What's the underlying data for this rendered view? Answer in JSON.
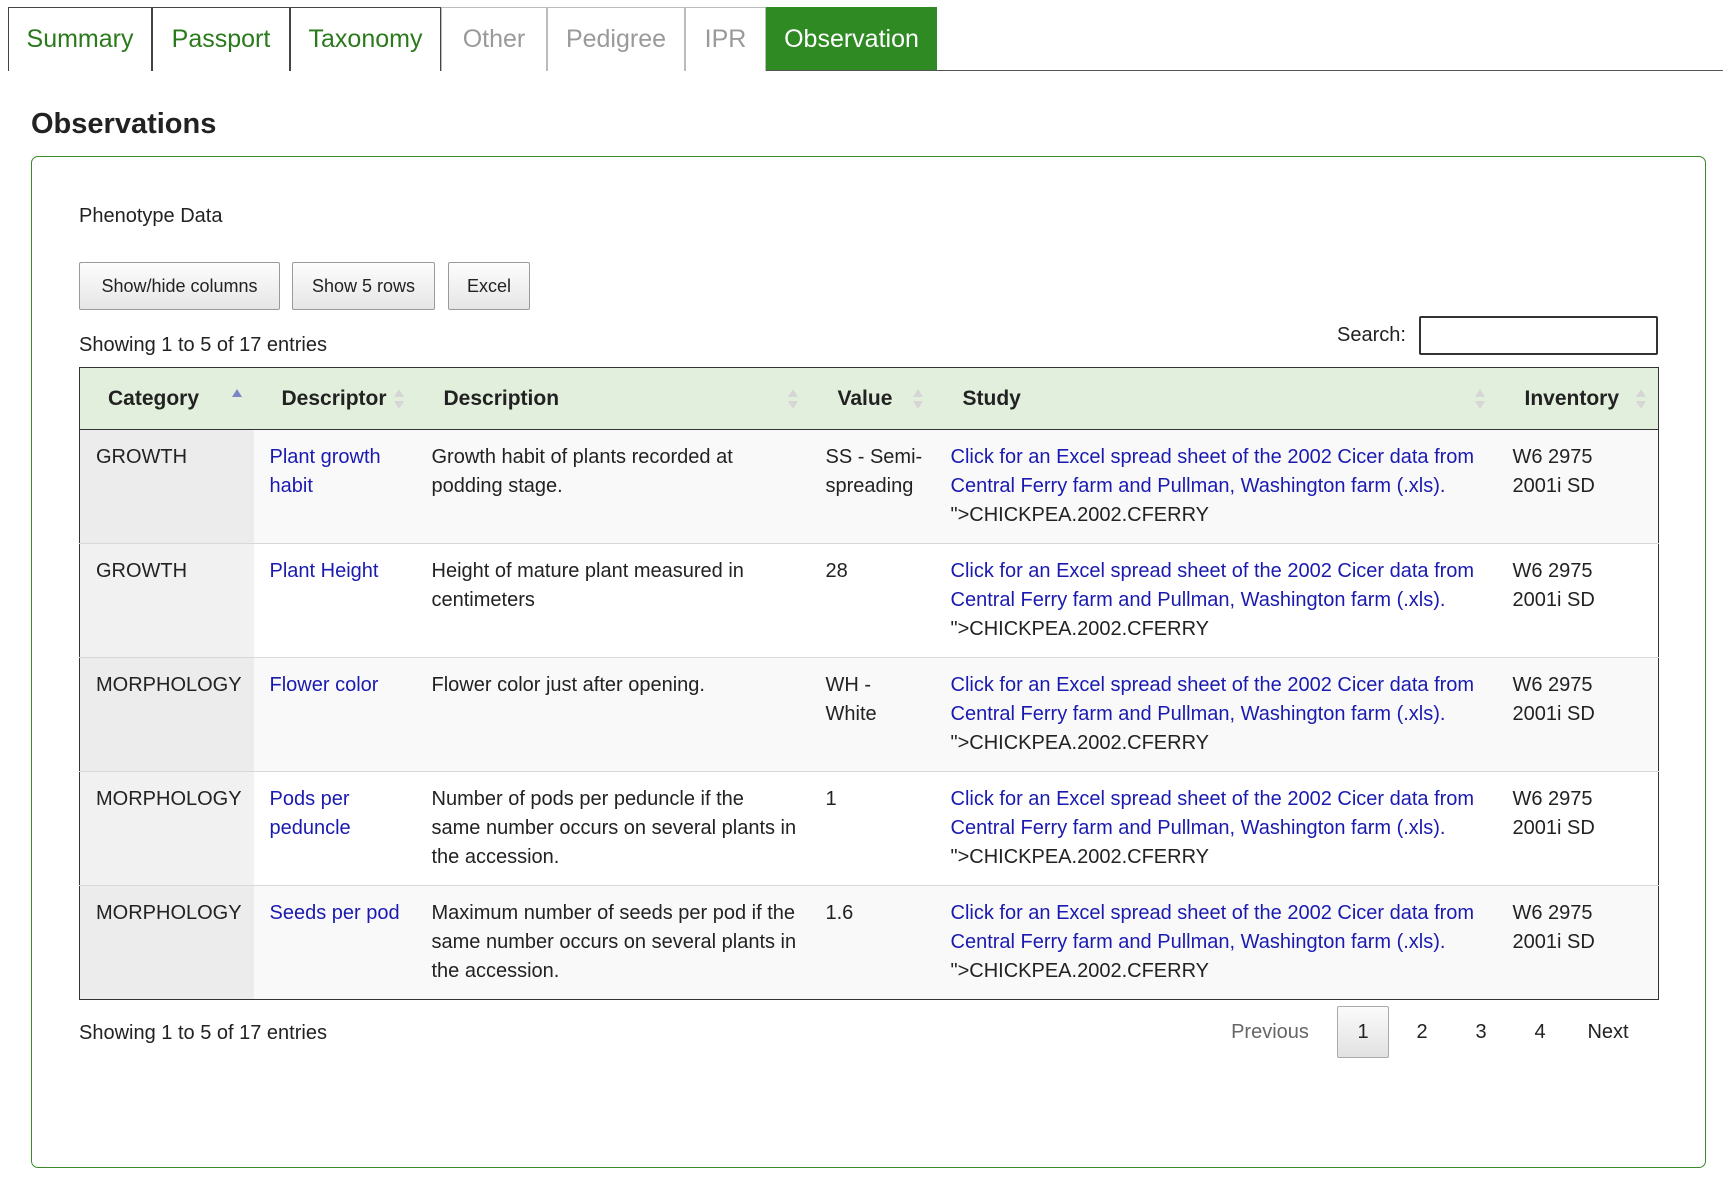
{
  "tabs": [
    {
      "label": "Summary",
      "state": "enabled"
    },
    {
      "label": "Passport",
      "state": "enabled"
    },
    {
      "label": "Taxonomy",
      "state": "enabled"
    },
    {
      "label": "Other",
      "state": "disabled"
    },
    {
      "label": "Pedigree",
      "state": "disabled"
    },
    {
      "label": "IPR",
      "state": "disabled"
    },
    {
      "label": "Observation",
      "state": "active"
    }
  ],
  "page_title": "Observations",
  "section_label": "Phenotype Data",
  "toolbar": {
    "colvis_label": "Show/hide columns",
    "rows_label": "Show 5 rows",
    "excel_label": "Excel"
  },
  "info_text": "Showing 1 to 5 of 17 entries",
  "search": {
    "label": "Search:",
    "value": "",
    "placeholder": ""
  },
  "table": {
    "columns": [
      "Category",
      "Descriptor",
      "Description",
      "Value",
      "Study",
      "Inventory"
    ],
    "sorted_column": "Category",
    "rows": [
      {
        "category": "GROWTH",
        "descriptor": "Plant growth habit",
        "description": "Growth habit of plants recorded at podding stage.",
        "value": "SS - Semi-spreading",
        "study_link": "Click for an Excel spread sheet of the 2002 Cicer data from Central Ferry farm and Pullman, Washington farm (.xls).",
        "study_suffix": " \">CHICKPEA.2002.CFERRY",
        "inventory": "W6 2975 2001i SD"
      },
      {
        "category": "GROWTH",
        "descriptor": "Plant Height",
        "description": "Height of mature plant measured in centimeters",
        "value": "28",
        "study_link": "Click for an Excel spread sheet of the 2002 Cicer data from Central Ferry farm and Pullman, Washington farm (.xls).",
        "study_suffix": " \">CHICKPEA.2002.CFERRY",
        "inventory": "W6 2975 2001i SD"
      },
      {
        "category": "MORPHOLOGY",
        "descriptor": "Flower color",
        "description": "Flower color just after opening.",
        "value": "WH - White",
        "study_link": "Click for an Excel spread sheet of the 2002 Cicer data from Central Ferry farm and Pullman, Washington farm (.xls).",
        "study_suffix": " \">CHICKPEA.2002.CFERRY",
        "inventory": "W6 2975 2001i SD"
      },
      {
        "category": "MORPHOLOGY",
        "descriptor": "Pods per peduncle",
        "description": "Number of pods per peduncle if the same number occurs on several plants in the accession.",
        "value": "1",
        "study_link": "Click for an Excel spread sheet of the 2002 Cicer data from Central Ferry farm and Pullman, Washington farm (.xls).",
        "study_suffix": " \">CHICKPEA.2002.CFERRY",
        "inventory": "W6 2975 2001i SD"
      },
      {
        "category": "MORPHOLOGY",
        "descriptor": "Seeds per pod",
        "description": "Maximum number of seeds per pod if the same number occurs on several plants in the accession.",
        "value": "1.6",
        "study_link": "Click for an Excel spread sheet of the 2002 Cicer data from Central Ferry farm and Pullman, Washington farm (.xls).",
        "study_suffix": " \">CHICKPEA.2002.CFERRY",
        "inventory": "W6 2975 2001i SD"
      }
    ]
  },
  "pagination": {
    "previous": "Previous",
    "pages": [
      "1",
      "2",
      "3",
      "4"
    ],
    "current": "1",
    "next": "Next"
  },
  "colors": {
    "tab_active_bg": "#2f8a23",
    "tab_text": "#2a7a1c",
    "header_bg": "#e2efdc",
    "link": "#1a1ab0",
    "panel_border": "#3a8a2c"
  },
  "icons": {
    "sort_ascending": "sort-ascending-icon",
    "sort_both": "sort-both-icon"
  }
}
